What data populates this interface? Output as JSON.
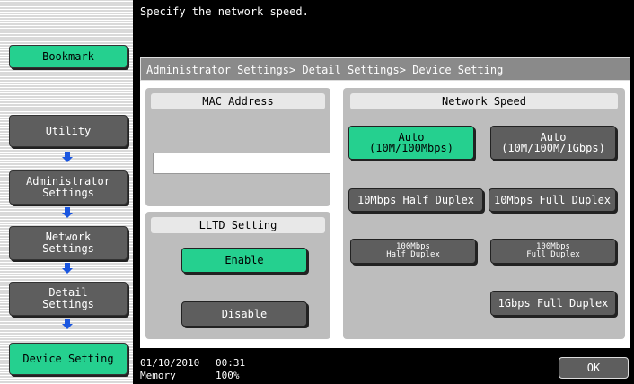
{
  "header": {
    "message": "Specify the network speed."
  },
  "breadcrumb": "Administrator Settings> Detail Settings> Device Setting",
  "sidebar": {
    "bookmark": "Bookmark",
    "items": [
      {
        "label": "Utility"
      },
      {
        "label": "Administrator\nSettings"
      },
      {
        "label": "Network\nSettings"
      },
      {
        "label": "Detail\nSettings"
      },
      {
        "label": "Device Setting"
      }
    ]
  },
  "mac_section": {
    "title": "MAC Address",
    "value": ""
  },
  "lltd_section": {
    "title": "LLTD Setting",
    "enable": "Enable",
    "disable": "Disable",
    "selected": "Enable"
  },
  "speed_section": {
    "title": "Network Speed",
    "options": [
      {
        "label": "Auto\n(10M/100Mbps)",
        "selected": true
      },
      {
        "label": "Auto\n(10M/100M/1Gbps)",
        "selected": false
      },
      {
        "label": "10Mbps Half Duplex",
        "selected": false
      },
      {
        "label": "10Mbps Full Duplex",
        "selected": false
      },
      {
        "label": "100Mbps\nHalf Duplex",
        "selected": false
      },
      {
        "label": "100Mbps\nFull Duplex",
        "selected": false
      },
      {
        "label": "1Gbps Full Duplex",
        "selected": false
      }
    ]
  },
  "status": {
    "date": "01/10/2010",
    "time": "00:31",
    "memory_label": "Memory",
    "memory_value": "100%"
  },
  "ok_label": "OK",
  "colors": {
    "selected": "#25d08f",
    "button": "#5e5e5e",
    "panel": "#000000"
  }
}
